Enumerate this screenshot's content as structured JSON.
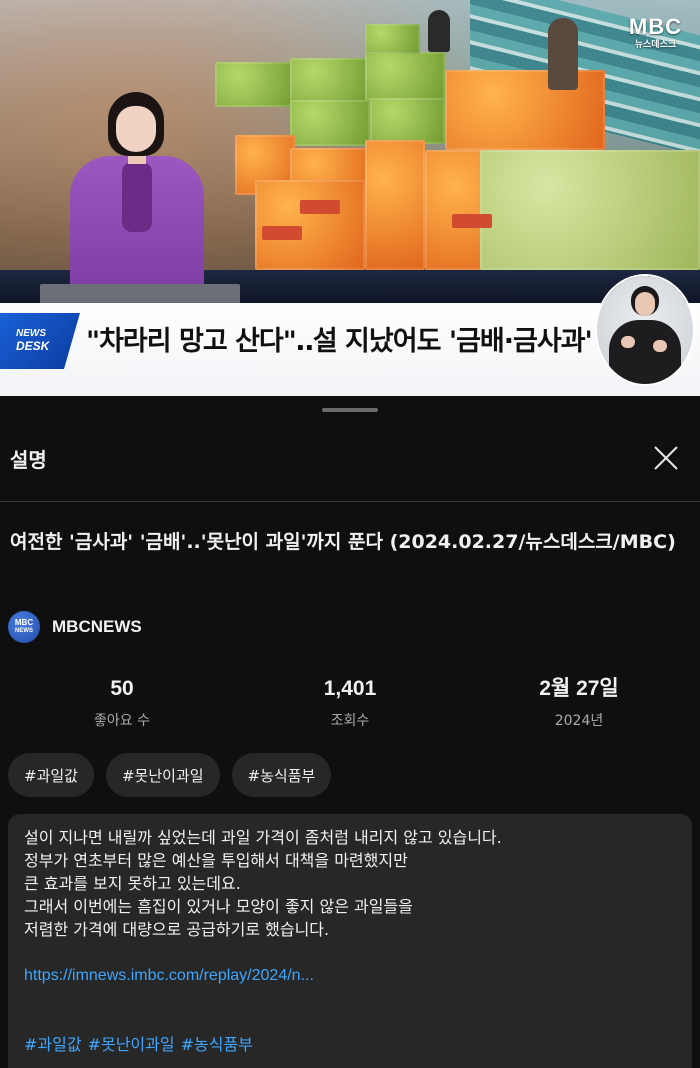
{
  "video": {
    "logo_main": "MBC",
    "logo_sub": "뉴스데스크",
    "badge_line1": "NEWS",
    "badge_line2": "DESK",
    "headline": "\"차라리 망고 산다\"‥설 지났어도 '금배·금사과'"
  },
  "sheet": {
    "title": "설명",
    "close_icon": "close-icon",
    "video_title": "여전한 '금사과' '금배'..'못난이 과일'까지 푼다 (2024.02.27/뉴스데스크/MBC)",
    "channel": {
      "avatar_line1": "MBC",
      "avatar_line2": "NEWS",
      "name": "MBCNEWS"
    },
    "stats": [
      {
        "value": "50",
        "label": "좋아요 수"
      },
      {
        "value": "1,401",
        "label": "조회수"
      },
      {
        "value": "2월 27일",
        "label": "2024년"
      }
    ],
    "chips": [
      "#과일값",
      "#못난이과일",
      "#농식품부"
    ],
    "description": {
      "lines": [
        "설이 지나면 내릴까 싶었는데 과일 가격이 좀처럼 내리지 않고 있습니다.",
        "정부가 연초부터 많은 예산을 투입해서 대책을 마련했지만",
        "큰 효과를 보지 못하고 있는데요.",
        "그래서 이번에는 흠집이 있거나 모양이 좋지 않은 과일들을",
        "저렴한 가격에 대량으로 공급하기로 했습니다."
      ],
      "link": "https://imnews.imbc.com/replay/2024/n...",
      "tags": [
        "#과일값",
        "#못난이과일",
        "#농식품부"
      ]
    }
  },
  "colors": {
    "background": "#0f0f0f",
    "surface": "#272727",
    "link": "#3ea6ff",
    "anchor_suit": "#9a58c0"
  }
}
